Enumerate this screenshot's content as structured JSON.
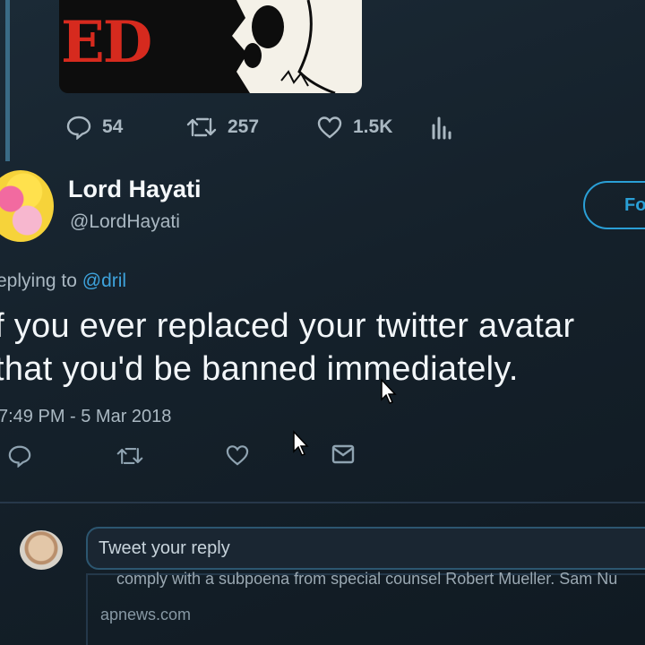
{
  "previous_tweet": {
    "media_text": "ED",
    "reply_count": "54",
    "retweet_count": "257",
    "like_count": "1.5K"
  },
  "tweet": {
    "display_name": "Lord Hayati",
    "handle": "@LordHayati",
    "follow_label": "Fo",
    "replying_prefix": "eplying to",
    "replying_to": "@dril",
    "text_line1": "f you ever replaced your twitter avatar",
    "text_line2": "that you'd be banned immediately.",
    "timestamp": "7:49 PM - 5 Mar 2018"
  },
  "reply_box": {
    "placeholder": "Tweet your reply"
  },
  "news_card": {
    "snippet": "comply with a subpoena from special counsel Robert Mueller. Sam Nu",
    "domain": "apnews.com"
  },
  "colors": {
    "background": "#15202b",
    "accent": "#2a9fd6",
    "secondary_text": "#aab8c2"
  },
  "icons": [
    "reply-icon",
    "retweet-icon",
    "like-icon",
    "analytics-icon",
    "message-icon",
    "mouse-cursor-icon"
  ]
}
